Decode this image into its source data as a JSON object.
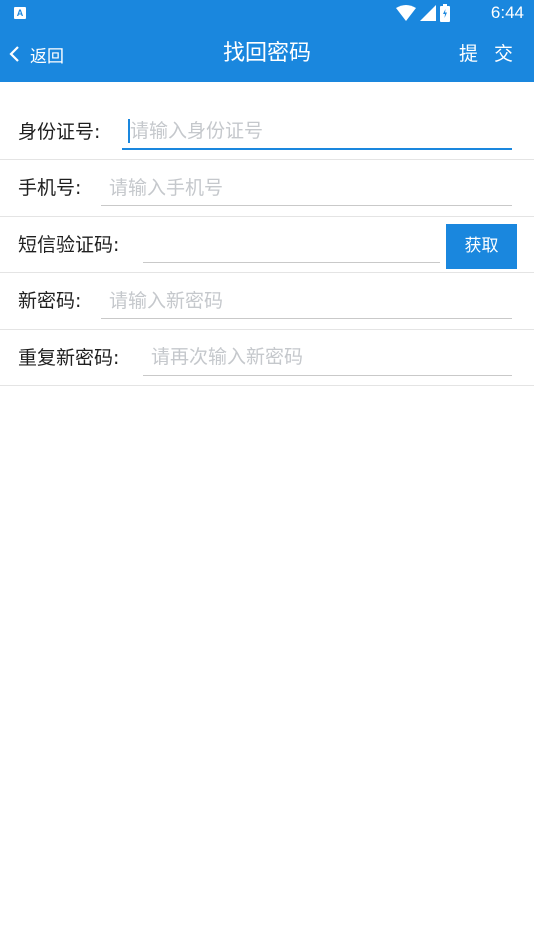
{
  "status_bar": {
    "time": "6:44",
    "icons": [
      "a-notification-icon",
      "wifi-icon",
      "cellular-signal-icon",
      "battery-icon"
    ]
  },
  "app_bar": {
    "back_label": "返回",
    "title": "找回密码",
    "submit_label": "提 交",
    "color": "#1a87de"
  },
  "form": {
    "id_number": {
      "label": "身份证号:",
      "placeholder": "请输入身份证号",
      "value": ""
    },
    "phone": {
      "label": "手机号:",
      "placeholder": "请输入手机号",
      "value": ""
    },
    "sms_code": {
      "label": "短信验证码:",
      "placeholder": "",
      "value": "",
      "button_label": "获取"
    },
    "new_password": {
      "label": "新密码:",
      "placeholder": "请输入新密码",
      "value": ""
    },
    "repeat_password": {
      "label": "重复新密码:",
      "placeholder": "请再次输入新密码",
      "value": ""
    }
  }
}
